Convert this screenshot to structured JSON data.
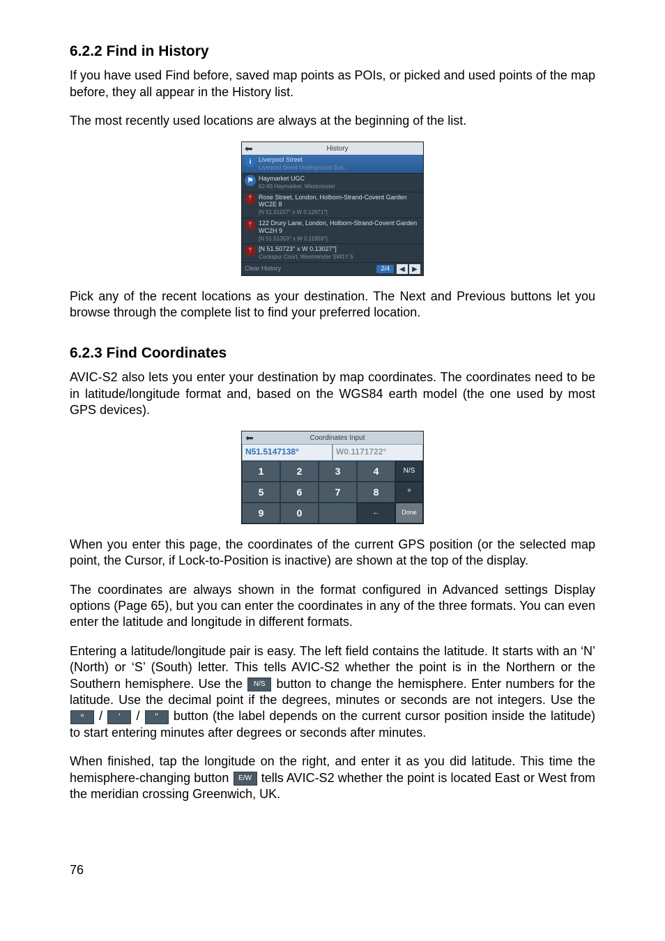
{
  "s622": {
    "heading": "6.2.2  Find in History",
    "p1": "If you have used Find before, saved map points as POIs, or picked and used points of the map before, they all appear in the History list.",
    "p2": " The most recently used locations are always at the beginning of the list.",
    "p3": "Pick any of the recent locations as your destination. The Next and Previous buttons let you browse through the complete list to find your preferred location."
  },
  "history_img": {
    "title": "History",
    "rows": [
      {
        "main": "Liverpool Street",
        "sub": "Liverpool Street Underground Stat..."
      },
      {
        "main": "Haymarket UGC",
        "sub": "62-65 Haymarket, Westminster"
      },
      {
        "main": "Rose Street, London, Holborn-Strand-Covent Garden WC2E 8",
        "sub": "[N 51.51157° x W 0.12671°]"
      },
      {
        "main": "122 Drury Lane, London, Holborn-Strand-Covent Garden WC2H 9",
        "sub": "[N 51.51353° x W 0.11959°]"
      },
      {
        "main": "[N 51.50723° x W 0.13027°]",
        "sub": "Cockspur Court, Westminster SW1Y 5"
      }
    ],
    "clear": "Clear History",
    "page": "2/4"
  },
  "s623": {
    "heading": "6.2.3  Find Coordinates",
    "p1": "AVIC-S2 also lets you enter your destination by map coordinates. The coordinates need to be in latitude/longitude format and, based on the WGS84 earth model (the one used by most GPS devices).",
    "p2": "When you enter this page, the coordinates of the current GPS position (or the selected map point, the Cursor, if Lock-to-Position is inactive) are shown at the top of the display.",
    "p3": "The coordinates are always shown in the format configured in Advanced settings Display options (Page 65), but you can enter the coordinates in any of the three formats. You can even enter the latitude and longitude in different formats.",
    "p4a": "Entering a latitude/longitude pair is easy. The left field contains the latitude. It starts with an ‘N’ (North) or ‘S’ (South) letter. This tells AVIC-S2 whether the point is in the Northern or the Southern hemisphere. Use the ",
    "p4b": " button to change the hemisphere. Enter numbers for the latitude. Use the decimal point if the degrees, minutes or seconds are not integers. Use the ",
    "p4c": " button (the label depends on the current cursor position inside the latitude) to start entering minutes after degrees or seconds after minutes.",
    "p5a": "When finished, tap the longitude on the right, and enter it as you did latitude. This time the hemisphere-changing button ",
    "p5b": " tells AVIC-S2 whether the point is located East or West from the meridian crossing Greenwich, UK."
  },
  "coord_img": {
    "title": "Coordinates Input",
    "lat": "N51.5147138°",
    "lon": "W0.1171722°",
    "keys": [
      "1",
      "2",
      "3",
      "4",
      "5",
      "6",
      "7",
      "8",
      "9",
      "0"
    ],
    "ns": "N/S",
    "deg": "°",
    "back": "←",
    "done": "Done"
  },
  "inline": {
    "ns": "N/S",
    "deg": "°",
    "min": "'",
    "sec": "\"",
    "sep": " / ",
    "ew": "E/W"
  },
  "page_number": "76"
}
